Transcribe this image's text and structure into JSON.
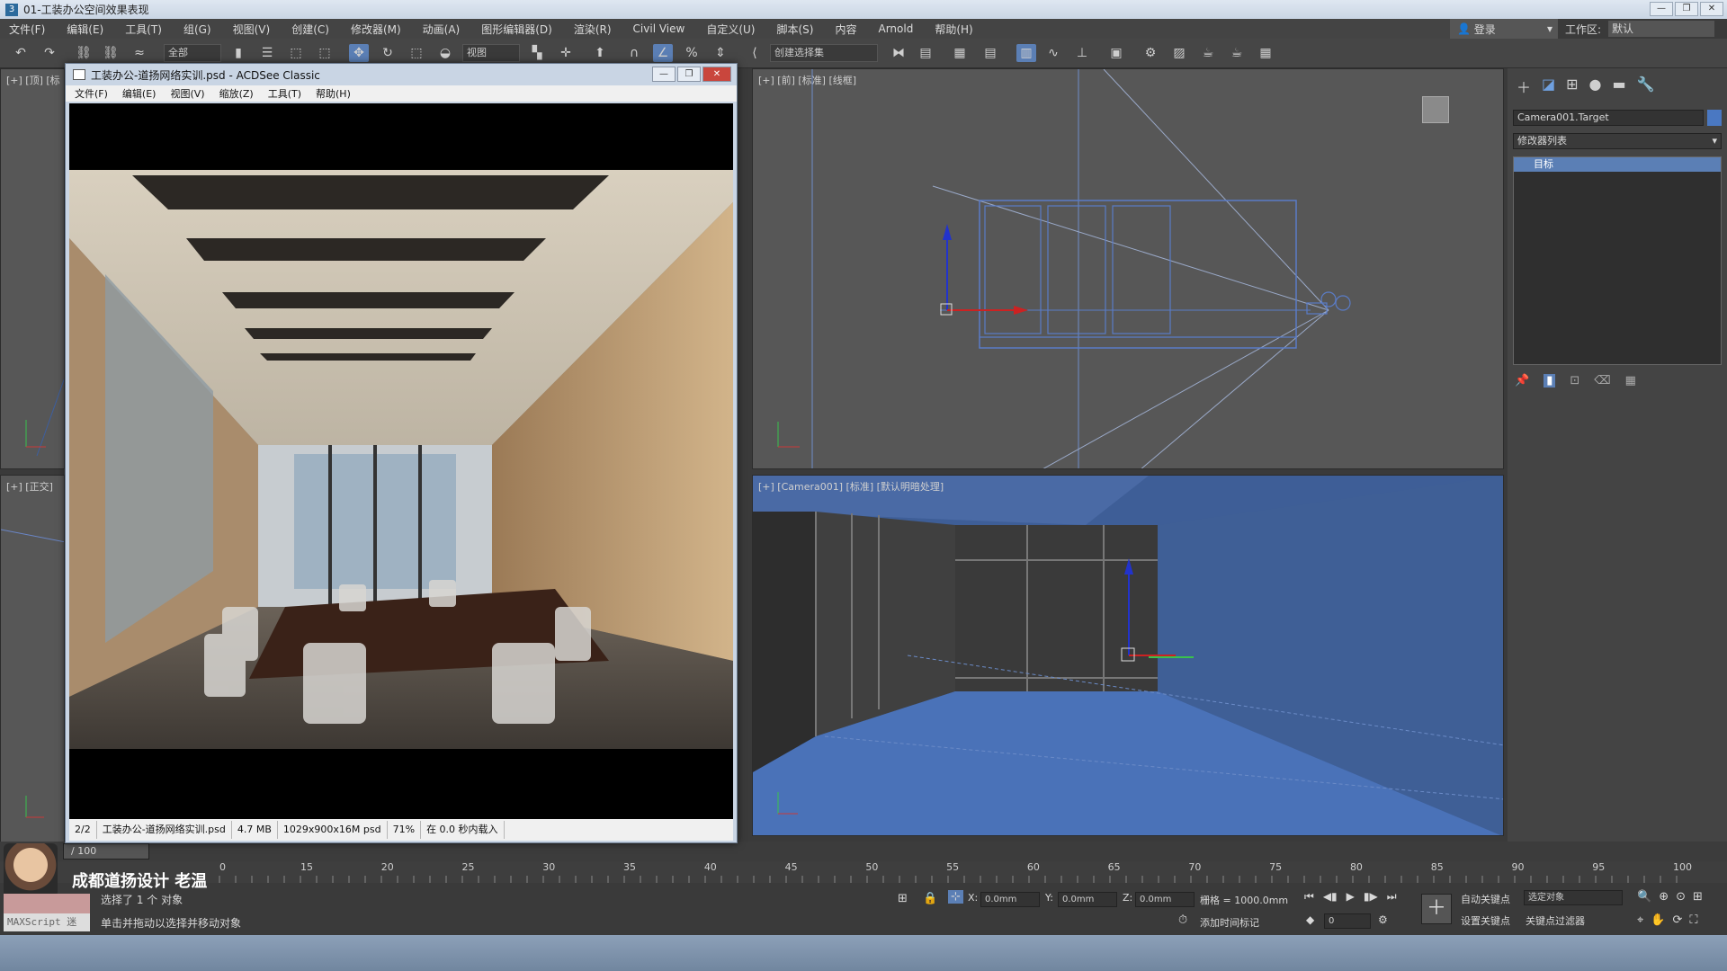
{
  "window_title": "01-工装办公空间效果表现",
  "menus": [
    "文件(F)",
    "编辑(E)",
    "工具(T)",
    "组(G)",
    "视图(V)",
    "创建(C)",
    "修改器(M)",
    "动画(A)",
    "图形编辑器(D)",
    "渲染(R)",
    "Civil View",
    "自定义(U)",
    "脚本(S)",
    "内容",
    "Arnold",
    "帮助(H)"
  ],
  "login_label": "登录",
  "workspace": {
    "label": "工作区:",
    "value": "默认"
  },
  "toolbar": {
    "filter_value": "全部",
    "view_value": "视图",
    "selection_set": "创建选择集"
  },
  "viewports": {
    "top_left_label": "[+] [顶] [标",
    "mid_left_label": "[+] [正交]",
    "front_label": "[+] [前] [标准] [线框]",
    "camera_label": "[+] [Camera001] [标准] [默认明暗处理]"
  },
  "command_panel": {
    "object_name": "Camera001.Target",
    "modifier_list": "修改器列表",
    "stack_item": "目标"
  },
  "acdsee": {
    "title": "工装办公-道扬网络实训.psd - ACDSee Classic",
    "menus": [
      "文件(F)",
      "编辑(E)",
      "视图(V)",
      "缩放(Z)",
      "工具(T)",
      "帮助(H)"
    ],
    "status": [
      "2/2",
      "工装办公-道扬网络实训.psd",
      "4.7 MB",
      "1029x900x16M psd",
      "71%",
      "在 0.0 秒内载入"
    ]
  },
  "timeline": {
    "counter": "/ 100",
    "ticks": [
      "0",
      "15",
      "20",
      "25",
      "30",
      "35",
      "40",
      "45",
      "50",
      "55",
      "60",
      "65",
      "70",
      "75",
      "80",
      "85",
      "90",
      "95",
      "100"
    ]
  },
  "status": {
    "brand": "成都道扬设计 老温",
    "maxscript": "MAXScript 迷",
    "selected": "选择了 1 个 对象",
    "hint": "单击并拖动以选择并移动对象",
    "x_label": "X:",
    "x_value": "0.0mm",
    "y_label": "Y:",
    "y_value": "0.0mm",
    "z_label": "Z:",
    "z_value": "0.0mm",
    "grid": "栅格 = 1000.0mm",
    "add_time_tag": "添加时间标记",
    "auto_key": "自动关键点",
    "selected_object": "选定对象",
    "set_key": "设置关键点",
    "key_filters": "关键点过滤器",
    "frame_value": "0"
  },
  "colors": {
    "accent": "#5b7fb5",
    "camera_view": "#3e5e97",
    "wire_blue": "#5a7cc7"
  }
}
